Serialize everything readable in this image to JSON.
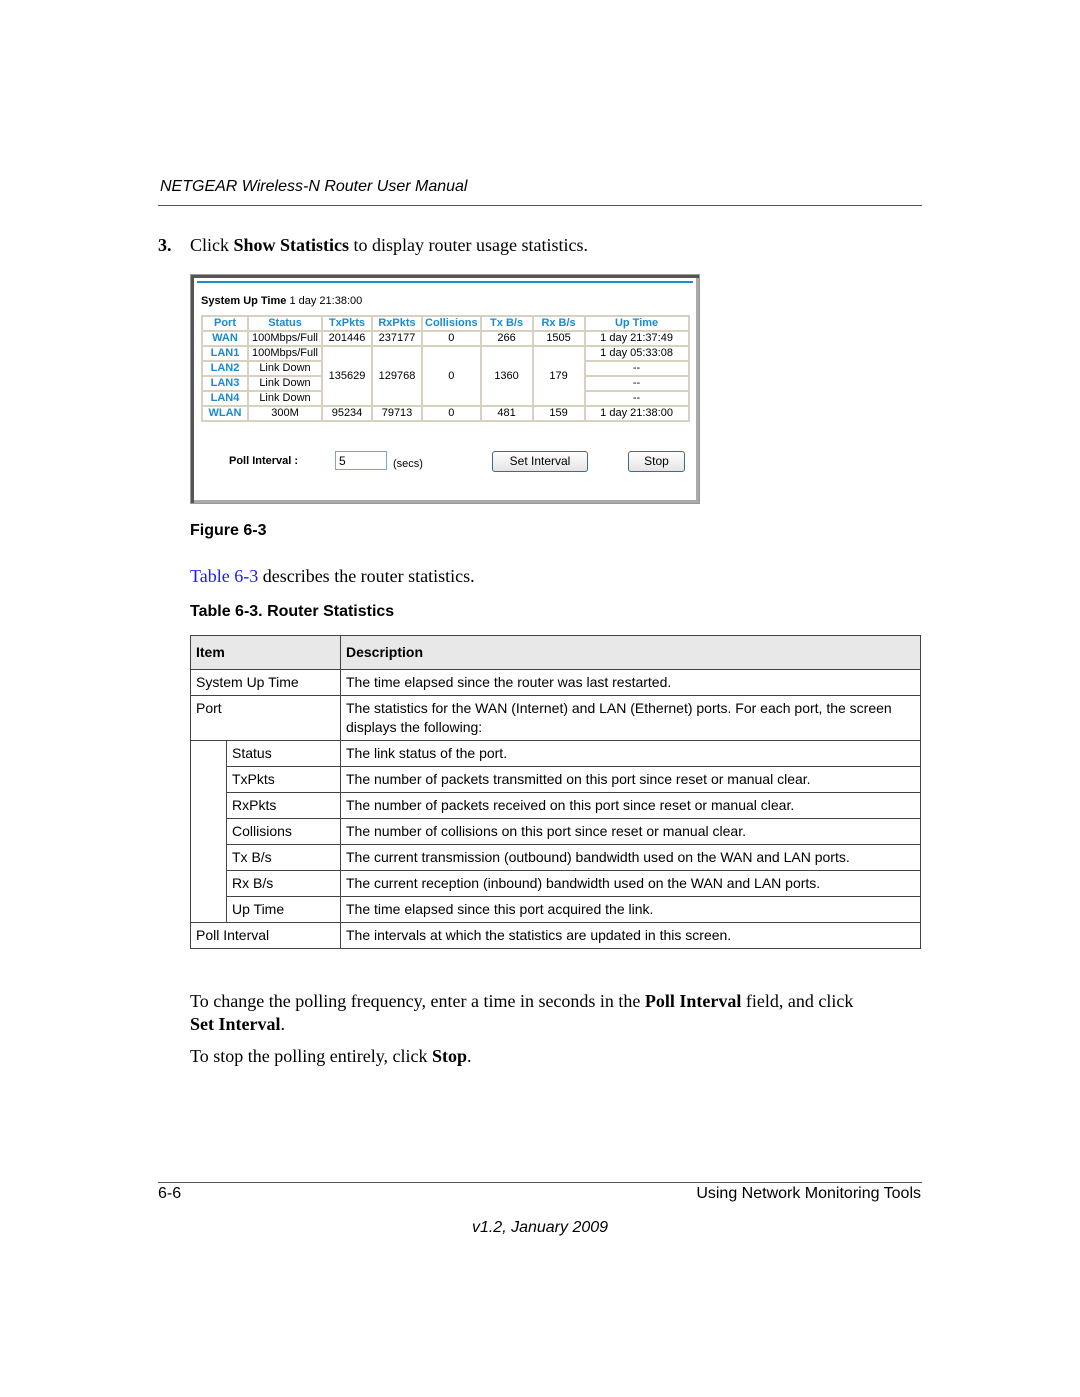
{
  "header": {
    "title": "NETGEAR Wireless-N Router User Manual"
  },
  "step": {
    "number": "3.",
    "pre": "Click ",
    "bold": "Show Statistics",
    "post": " to display router usage statistics."
  },
  "screenshot": {
    "uptime_label": "System Up Time",
    "uptime_value": "1 day 21:38:00",
    "columns": [
      "Port",
      "Status",
      "TxPkts",
      "RxPkts",
      "Collisions",
      "Tx B/s",
      "Rx B/s",
      "Up Time"
    ],
    "rows": [
      {
        "port": "WAN",
        "status": "100Mbps/Full",
        "txpkts": "201446",
        "rxpkts": "237177",
        "collisions": "0",
        "txbs": "266",
        "rxbs": "1505",
        "uptime": "1 day 21:37:49"
      },
      {
        "port": "LAN1",
        "status": "100Mbps/Full",
        "uptime": "1 day 05:33:08"
      },
      {
        "port": "LAN2",
        "status": "Link Down",
        "uptime": "--"
      },
      {
        "port": "LAN3",
        "status": "Link Down",
        "uptime": "--"
      },
      {
        "port": "LAN4",
        "status": "Link Down",
        "uptime": "--"
      },
      {
        "port": "WLAN",
        "status": "300M",
        "txpkts": "95234",
        "rxpkts": "79713",
        "collisions": "0",
        "txbs": "481",
        "rxbs": "159",
        "uptime": "1 day 21:38:00"
      }
    ],
    "lan_shared": {
      "txpkts": "135629",
      "rxpkts": "129768",
      "collisions": "0",
      "txbs": "1360",
      "rxbs": "179"
    },
    "poll_label": "Poll Interval :",
    "poll_value": "5",
    "poll_unit": "(secs)",
    "set_interval_label": "Set Interval",
    "stop_label": "Stop"
  },
  "figure_caption": "Figure 6-3",
  "desc": {
    "link": "Table 6-3",
    "rest": " describes the router statistics."
  },
  "table_title": "Table 6-3. Router Statistics",
  "rtable": {
    "headers": [
      "Item",
      "Description"
    ],
    "rows": [
      {
        "item": "System Up Time",
        "desc": "The time elapsed since the router was last restarted."
      },
      {
        "item": "Port",
        "desc": "The statistics for the WAN (Internet) and LAN (Ethernet) ports. For each port, the screen displays the following:"
      },
      {
        "item": "Status",
        "desc": "The link status of the port."
      },
      {
        "item": "TxPkts",
        "desc": "The number of packets transmitted on this port since reset or manual clear."
      },
      {
        "item": "RxPkts",
        "desc": "The number of packets received on this port since reset or manual clear."
      },
      {
        "item": "Collisions",
        "desc": "The number of collisions on this port since reset or manual clear."
      },
      {
        "item": "Tx B/s",
        "desc": "The current transmission (outbound) bandwidth used on the WAN and LAN ports."
      },
      {
        "item": "Rx B/s",
        "desc": "The current reception (inbound) bandwidth used on the WAN and LAN ports."
      },
      {
        "item": "Up Time",
        "desc": "The time elapsed since this port acquired the link."
      },
      {
        "item": "Poll Interval",
        "desc": "The intervals at which the statistics are updated in this screen."
      }
    ]
  },
  "para1": {
    "t1": "To change the polling frequency, enter a time in seconds in the ",
    "b1": "Poll Interval",
    "t2": " field, and click ",
    "b2": "Set Interval",
    "t3": "."
  },
  "para2": {
    "t1": "To stop the polling entirely, click ",
    "b1": "Stop",
    "t2": "."
  },
  "footer": {
    "page": "6-6",
    "section": "Using Network Monitoring Tools",
    "version": "v1.2, January 2009"
  }
}
